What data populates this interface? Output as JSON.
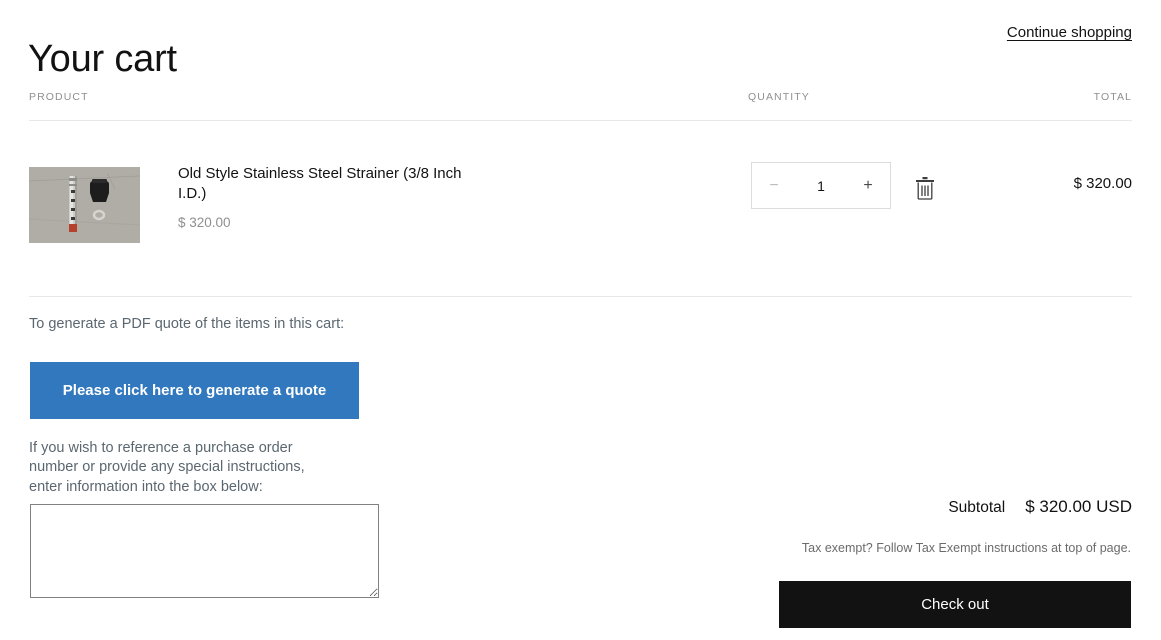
{
  "header": {
    "title": "Your cart",
    "continue_shopping": "Continue shopping"
  },
  "table": {
    "columns": {
      "product": "PRODUCT",
      "quantity": "QUANTITY",
      "total": "TOTAL"
    },
    "rows": [
      {
        "title": "Old Style Stainless Steel Strainer (3/8 Inch I.D.)",
        "unit_price": "$ 320.00",
        "quantity": "1",
        "line_total": "$ 320.00",
        "decrease_label": "−",
        "increase_label": "+",
        "remove_label": "trash-icon",
        "image_alt": "stainless steel strainer tube with black cap and ring on concrete"
      }
    ]
  },
  "quote": {
    "intro": "To generate a PDF quote of the items in this cart:",
    "button_label": "Please click here to generate a quote",
    "button_color": "#3178be",
    "po_note": "If you wish to reference a purchase order\nnumber or provide any special instructions,\nenter information into the box below:",
    "po_value": "",
    "po_placeholder": ""
  },
  "summary": {
    "subtotal_label": "Subtotal",
    "subtotal_value": "$ 320.00 USD",
    "tax_note": "Tax exempt? Follow Tax Exempt instructions at top of page.",
    "checkout_label": "Check out",
    "checkout_color": "#121212"
  }
}
